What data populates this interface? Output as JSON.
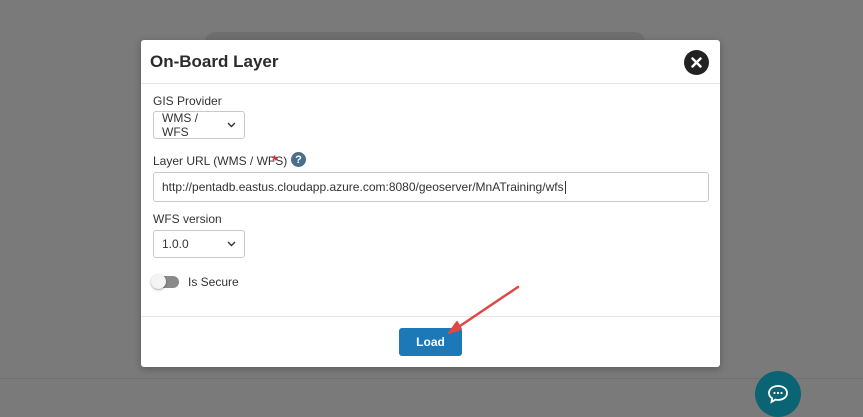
{
  "modal": {
    "title": "On-Board Layer",
    "gis_provider": {
      "label": "GIS Provider",
      "selected": "WMS / WFS"
    },
    "layer_url": {
      "label": "Layer URL (WMS / WFS)",
      "required_mark": "*",
      "help_glyph": "?",
      "value": "http://pentadb.eastus.cloudapp.azure.com:8080/geoserver/MnATraining/wfs"
    },
    "wfs_version": {
      "label": "WFS version",
      "selected": "1.0.0"
    },
    "secure_toggle": {
      "label": "Is Secure",
      "on": false
    },
    "load_label": "Load"
  },
  "colors": {
    "overlay": "#7a7a7a",
    "primary_button": "#1d78b8",
    "required": "#e0232e",
    "chat_button": "#0b6473",
    "annotation_arrow": "#e04848"
  },
  "icons": {
    "close": "close-icon",
    "help": "help-icon",
    "chat": "chat-icon",
    "dropdown": "chevron-down-icon"
  }
}
